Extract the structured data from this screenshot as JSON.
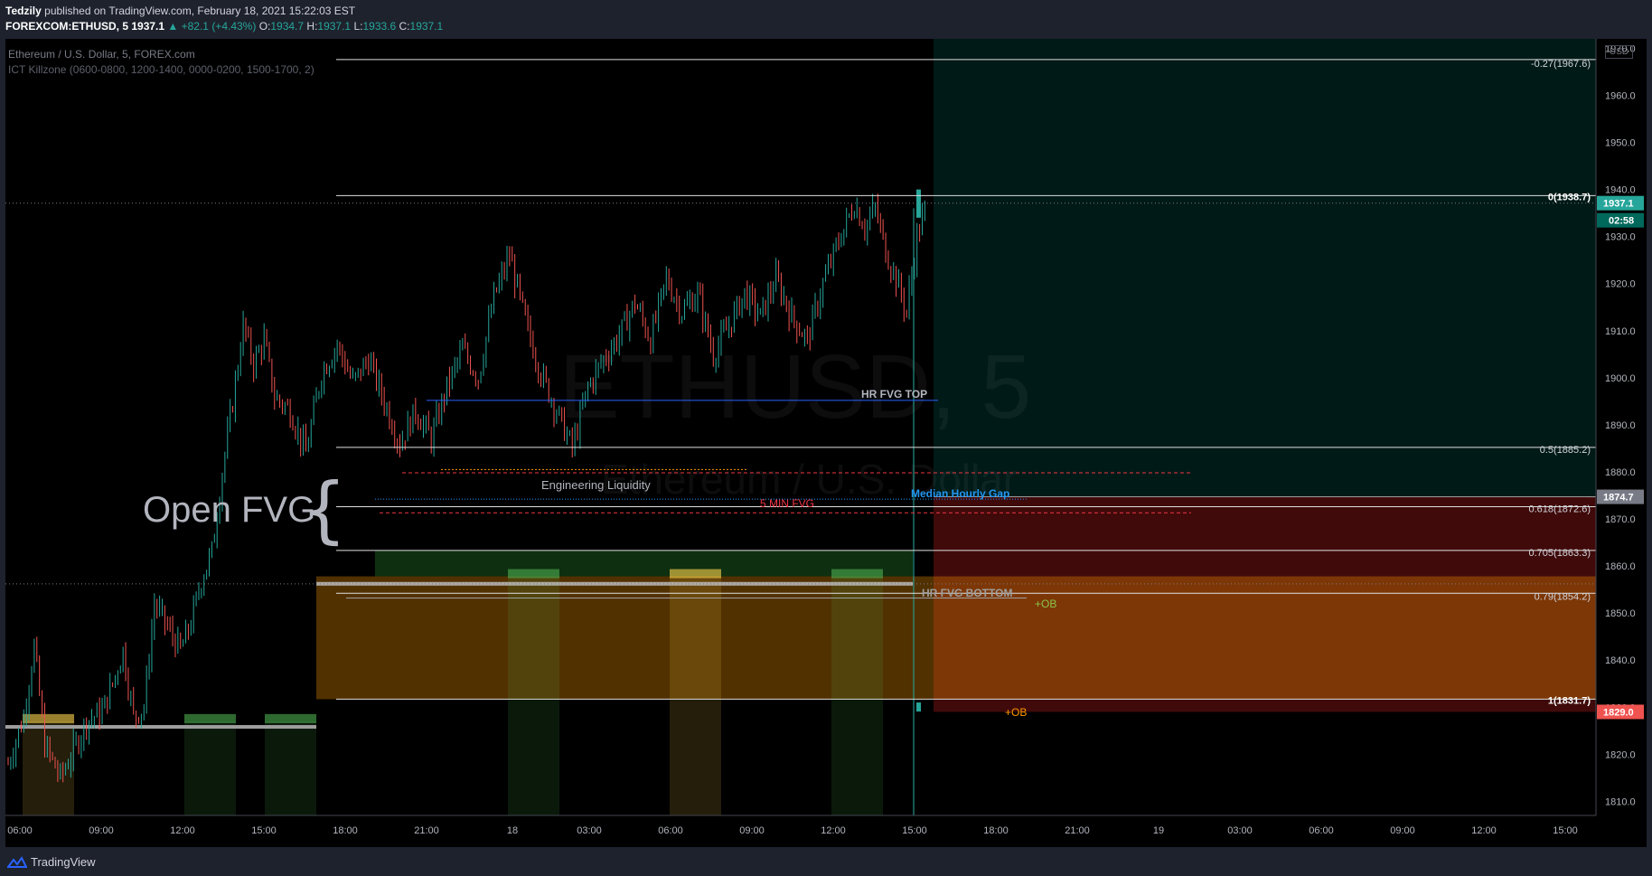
{
  "header": {
    "author": "Tedzily",
    "published": "published on TradingView.com, February 18, 2021 15:22:03 EST",
    "symbol": "FOREXCOM:ETHUSD, 5",
    "last": "1937.1",
    "change": "▲ +82.1 (+4.43%)",
    "o_label": "O:",
    "o": "1934.7",
    "h_label": "H:",
    "h": "1937.1",
    "l_label": "L:",
    "l": "1933.6",
    "c_label": "C:",
    "c": "1937.1"
  },
  "legend": {
    "title": "Ethereum / U.S. Dollar, 5, FOREX.com",
    "indicator": "ICT Killzone (0600-0800, 1200-1400, 0000-0200, 1500-1700, 2)"
  },
  "watermark": {
    "symbol": "ETHUSD, 5",
    "name": "Ethereum / U.S. Dollar"
  },
  "currency_button": "USD",
  "footer": {
    "brand": "TradingView"
  },
  "colors": {
    "background": "#000000",
    "up_candle": "#26a69a",
    "down_candle": "#ef5350",
    "fib_line": "#e0e0e0",
    "hr_fvg_top_line": "#2962ff",
    "liquidity_line": "#f23645",
    "median_label": "#2196f3",
    "ob_green": "#8bc34a",
    "ob_orange": "#ff9800"
  },
  "annotations": {
    "open_fvg": "Open FVG",
    "open_fvg_brace": "{",
    "hr_fvg_top": "HR FVG TOP",
    "engineering_liquidity": "Engineering Liquidity",
    "median_hourly_gap": "Median Hourly Gap",
    "five_min_fvg": "5 MIN FVG",
    "hr_fvg_bottom": "HR FVG BOTTOM",
    "ob_upper": "+OB",
    "ob_lower": "+OB"
  },
  "chart_data": {
    "type": "candlestick",
    "symbol": "ETHUSD",
    "interval": "5",
    "ylim": [
      1807,
      1972
    ],
    "y_ticks": [
      1810,
      1820,
      1830,
      1840,
      1850,
      1860,
      1870,
      1880,
      1890,
      1900,
      1910,
      1920,
      1930,
      1940,
      1950,
      1960,
      1970
    ],
    "y_tick_labels": [
      "1810.0",
      "1820.0",
      "1830.0",
      "1840.0",
      "1850.0",
      "1860.0",
      "1870.0",
      "1880.0",
      "1890.0",
      "1900.0",
      "1910.0",
      "1920.0",
      "1930.0",
      "1940.0",
      "1950.0",
      "1960.0",
      "1970.0"
    ],
    "x_ticks": [
      "06:00",
      "09:00",
      "12:00",
      "15:00",
      "18:00",
      "21:00",
      "18",
      "03:00",
      "06:00",
      "09:00",
      "12:00",
      "15:00",
      "18:00",
      "21:00",
      "19",
      "03:00",
      "06:00",
      "09:00",
      "12:00",
      "15:00"
    ],
    "price_path": [
      [
        0,
        1818
      ],
      [
        6,
        1828
      ],
      [
        10,
        1843
      ],
      [
        14,
        1822
      ],
      [
        20,
        1815
      ],
      [
        26,
        1822
      ],
      [
        30,
        1827
      ],
      [
        36,
        1829
      ],
      [
        40,
        1835
      ],
      [
        44,
        1842
      ],
      [
        48,
        1828
      ],
      [
        52,
        1830
      ],
      [
        56,
        1852
      ],
      [
        60,
        1848
      ],
      [
        66,
        1842
      ],
      [
        70,
        1848
      ],
      [
        74,
        1857
      ],
      [
        78,
        1863
      ],
      [
        82,
        1880
      ],
      [
        86,
        1895
      ],
      [
        90,
        1911
      ],
      [
        94,
        1903
      ],
      [
        98,
        1908
      ],
      [
        102,
        1896
      ],
      [
        108,
        1893
      ],
      [
        114,
        1884
      ],
      [
        120,
        1901
      ],
      [
        126,
        1907
      ],
      [
        132,
        1899
      ],
      [
        138,
        1904
      ],
      [
        144,
        1895
      ],
      [
        150,
        1886
      ],
      [
        156,
        1893
      ],
      [
        162,
        1887
      ],
      [
        168,
        1898
      ],
      [
        174,
        1906
      ],
      [
        180,
        1900
      ],
      [
        186,
        1917
      ],
      [
        192,
        1926
      ],
      [
        198,
        1912
      ],
      [
        204,
        1901
      ],
      [
        210,
        1893
      ],
      [
        216,
        1885
      ],
      [
        222,
        1898
      ],
      [
        228,
        1904
      ],
      [
        234,
        1909
      ],
      [
        240,
        1916
      ],
      [
        246,
        1908
      ],
      [
        252,
        1921
      ],
      [
        258,
        1914
      ],
      [
        264,
        1918
      ],
      [
        270,
        1905
      ],
      [
        276,
        1911
      ],
      [
        282,
        1918
      ],
      [
        288,
        1913
      ],
      [
        294,
        1921
      ],
      [
        300,
        1913
      ],
      [
        306,
        1908
      ],
      [
        312,
        1920
      ],
      [
        318,
        1929
      ],
      [
        324,
        1937
      ],
      [
        328,
        1932
      ],
      [
        332,
        1936
      ],
      [
        336,
        1927
      ],
      [
        340,
        1921
      ],
      [
        344,
        1914
      ],
      [
        348,
        1930
      ],
      [
        352,
        1937
      ]
    ],
    "current_price": "1937.1",
    "countdown": "02:58",
    "price_markers": [
      {
        "value": 1874.7,
        "label": "1874.7",
        "color": "#787b86"
      },
      {
        "value": 1829.0,
        "label": "1829.0",
        "color": "#ef5350"
      }
    ],
    "fib_levels": [
      {
        "ratio": "-0.27",
        "price": 1967.6,
        "label": "-0.27(1967.6)"
      },
      {
        "ratio": "0",
        "price": 1938.7,
        "label": "0(1938.7)"
      },
      {
        "ratio": "0.5",
        "price": 1885.2,
        "label": "0.5(1885.2)"
      },
      {
        "ratio": "0.618",
        "price": 1872.6,
        "label": "0.618(1872.6)"
      },
      {
        "ratio": "0.705",
        "price": 1863.3,
        "label": "0.705(1863.3)"
      },
      {
        "ratio": "0.79",
        "price": 1854.2,
        "label": "0.79(1854.2)"
      },
      {
        "ratio": "1",
        "price": 1831.7,
        "label": "1(1831.7)"
      }
    ],
    "zones": [
      {
        "name": "target-zone",
        "from": 1874.7,
        "to": 1972,
        "color": "#00695c"
      },
      {
        "name": "stop-zone",
        "from": 1829.0,
        "to": 1874.7,
        "color": "#b71c1c"
      },
      {
        "name": "order-block-zone",
        "from": 1831.7,
        "to": 1857.8,
        "color": "#ff9800"
      },
      {
        "name": "green-fvg-zone",
        "from": 1857.8,
        "to": 1863.3,
        "color": "#1b5e20"
      }
    ],
    "killzones": [
      "0600-0800",
      "1200-1400",
      "0000-0200",
      "1500-1700"
    ]
  }
}
